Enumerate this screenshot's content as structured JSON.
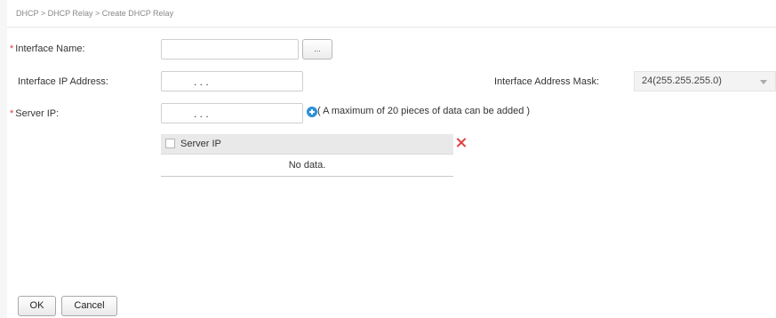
{
  "breadcrumb": "DHCP > DHCP Relay > Create DHCP Relay",
  "required_marker": "*",
  "form": {
    "interface_name_label": "Interface Name:",
    "interface_name_value": "",
    "browse_label": "...",
    "interface_ip_label": "Interface IP Address:",
    "interface_ip_dots": ".      .      .",
    "mask_label": "Interface Address Mask:",
    "mask_value": "24(255.255.255.0)",
    "server_ip_label": "Server IP:",
    "server_ip_dots": ".      .      .",
    "server_ip_hint": "( A maximum of 20 pieces of data can be added )"
  },
  "table": {
    "column_header": "Server IP",
    "empty_text": "No data."
  },
  "buttons": {
    "ok": "OK",
    "cancel": "Cancel"
  },
  "colors": {
    "required": "#e23c3c",
    "add_icon": "#2c8fd8",
    "delete_icon": "#e23c3c"
  },
  "icons": {
    "add": "plus-circle-icon",
    "delete": "close-icon",
    "dropdown": "chevron-down-icon"
  }
}
